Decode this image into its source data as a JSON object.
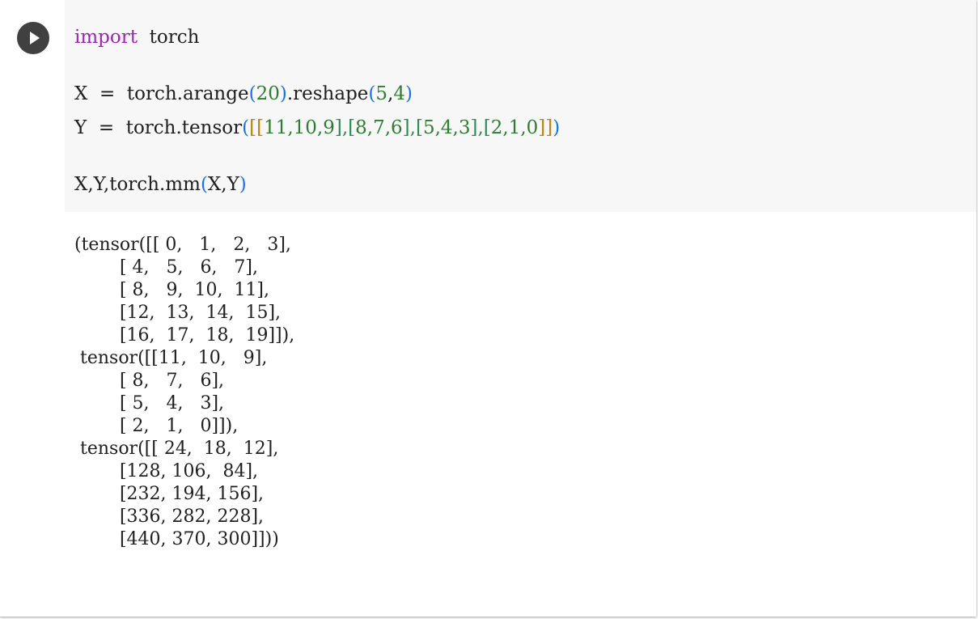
{
  "cell": {
    "run_button": {
      "icon": "play-icon",
      "label": ""
    },
    "code": {
      "line1": {
        "keyword": "import",
        "rest": "torch"
      },
      "line2": {
        "lhs": "X",
        "op": "=",
        "fn": "torch.arange",
        "arg": "20",
        "method": ".reshape",
        "a1": "5",
        "a2": "4"
      },
      "line3": {
        "lhs": "Y",
        "op": "=",
        "fn": "torch.tensor",
        "open": "[[",
        "r1": "11,10,9",
        "sep1": "],",
        "r2open": "[",
        "r2": "8,7,6",
        "r2close": "],",
        "r3open": "[",
        "r3": "5,4,3",
        "r3close": "],",
        "r4open": "[",
        "r4": "2,1,0",
        "close": "]]"
      },
      "line4": {
        "prefix": "X,Y,torch.mm",
        "args": "X,Y"
      }
    },
    "output": [
      "(tensor([[ 0,   1,   2,   3],",
      "        [ 4,   5,   6,   7],",
      "        [ 8,   9,  10,  11],",
      "        [12,  13,  14,  15],",
      "        [16,  17,  18,  19]]),",
      " tensor([[11,  10,   9],",
      "        [ 8,   7,   6],",
      "        [ 5,   4,   3],",
      "        [ 2,   1,   0]]),",
      " tensor([[ 24,  18,  12],",
      "        [128, 106,  84],",
      "        [232, 194, 156],",
      "        [336, 282, 228],",
      "        [440, 370, 300]]))"
    ]
  }
}
